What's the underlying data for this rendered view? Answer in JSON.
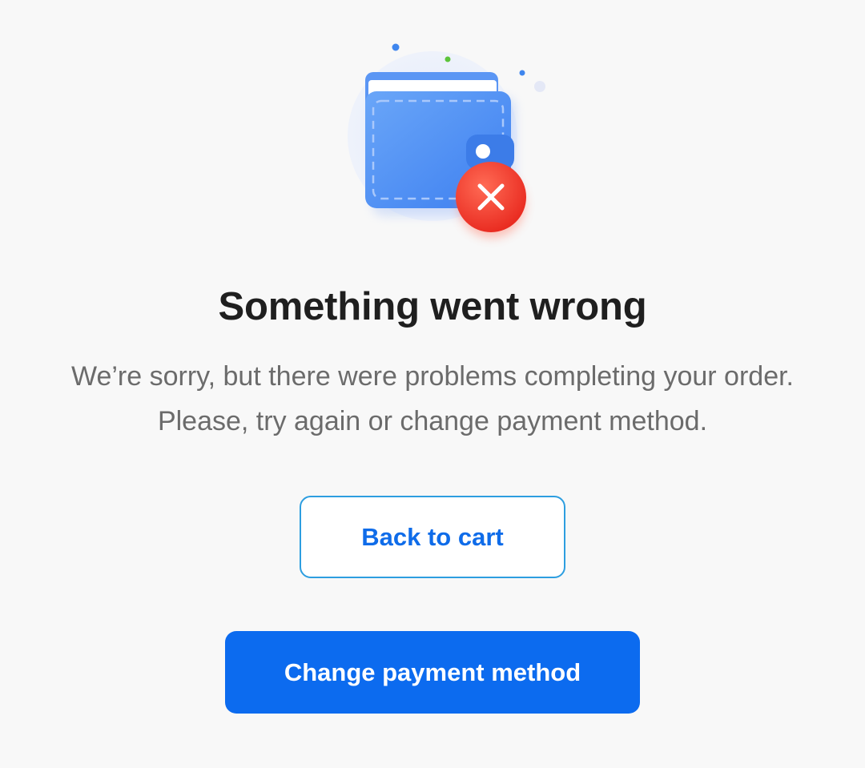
{
  "dialog": {
    "illustration_icon": "wallet-error-icon",
    "title": "Something went wrong",
    "message_line1": "We’re sorry, but there were problems completing your order.",
    "message_line2": "Please, try again or change payment method."
  },
  "actions": {
    "back_label": "Back to cart",
    "change_payment_label": "Change payment method"
  },
  "colors": {
    "background": "#f8f8f8",
    "primary": "#0c6bef",
    "outline_border": "#2d9ee0",
    "outline_text": "#0f6ce9",
    "error": "#ef3b2c",
    "wallet": "#4e8ff2"
  }
}
